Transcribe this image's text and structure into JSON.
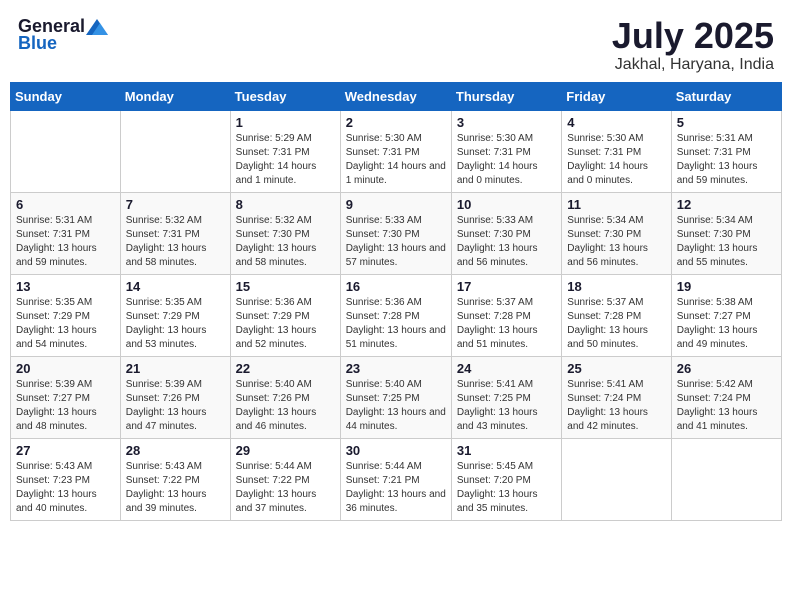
{
  "header": {
    "logo_general": "General",
    "logo_blue": "Blue",
    "title": "July 2025",
    "subtitle": "Jakhal, Haryana, India"
  },
  "days_of_week": [
    "Sunday",
    "Monday",
    "Tuesday",
    "Wednesday",
    "Thursday",
    "Friday",
    "Saturday"
  ],
  "weeks": [
    [
      {
        "day": "",
        "info": ""
      },
      {
        "day": "",
        "info": ""
      },
      {
        "day": "1",
        "info": "Sunrise: 5:29 AM\nSunset: 7:31 PM\nDaylight: 14 hours and 1 minute."
      },
      {
        "day": "2",
        "info": "Sunrise: 5:30 AM\nSunset: 7:31 PM\nDaylight: 14 hours and 1 minute."
      },
      {
        "day": "3",
        "info": "Sunrise: 5:30 AM\nSunset: 7:31 PM\nDaylight: 14 hours and 0 minutes."
      },
      {
        "day": "4",
        "info": "Sunrise: 5:30 AM\nSunset: 7:31 PM\nDaylight: 14 hours and 0 minutes."
      },
      {
        "day": "5",
        "info": "Sunrise: 5:31 AM\nSunset: 7:31 PM\nDaylight: 13 hours and 59 minutes."
      }
    ],
    [
      {
        "day": "6",
        "info": "Sunrise: 5:31 AM\nSunset: 7:31 PM\nDaylight: 13 hours and 59 minutes."
      },
      {
        "day": "7",
        "info": "Sunrise: 5:32 AM\nSunset: 7:31 PM\nDaylight: 13 hours and 58 minutes."
      },
      {
        "day": "8",
        "info": "Sunrise: 5:32 AM\nSunset: 7:30 PM\nDaylight: 13 hours and 58 minutes."
      },
      {
        "day": "9",
        "info": "Sunrise: 5:33 AM\nSunset: 7:30 PM\nDaylight: 13 hours and 57 minutes."
      },
      {
        "day": "10",
        "info": "Sunrise: 5:33 AM\nSunset: 7:30 PM\nDaylight: 13 hours and 56 minutes."
      },
      {
        "day": "11",
        "info": "Sunrise: 5:34 AM\nSunset: 7:30 PM\nDaylight: 13 hours and 56 minutes."
      },
      {
        "day": "12",
        "info": "Sunrise: 5:34 AM\nSunset: 7:30 PM\nDaylight: 13 hours and 55 minutes."
      }
    ],
    [
      {
        "day": "13",
        "info": "Sunrise: 5:35 AM\nSunset: 7:29 PM\nDaylight: 13 hours and 54 minutes."
      },
      {
        "day": "14",
        "info": "Sunrise: 5:35 AM\nSunset: 7:29 PM\nDaylight: 13 hours and 53 minutes."
      },
      {
        "day": "15",
        "info": "Sunrise: 5:36 AM\nSunset: 7:29 PM\nDaylight: 13 hours and 52 minutes."
      },
      {
        "day": "16",
        "info": "Sunrise: 5:36 AM\nSunset: 7:28 PM\nDaylight: 13 hours and 51 minutes."
      },
      {
        "day": "17",
        "info": "Sunrise: 5:37 AM\nSunset: 7:28 PM\nDaylight: 13 hours and 51 minutes."
      },
      {
        "day": "18",
        "info": "Sunrise: 5:37 AM\nSunset: 7:28 PM\nDaylight: 13 hours and 50 minutes."
      },
      {
        "day": "19",
        "info": "Sunrise: 5:38 AM\nSunset: 7:27 PM\nDaylight: 13 hours and 49 minutes."
      }
    ],
    [
      {
        "day": "20",
        "info": "Sunrise: 5:39 AM\nSunset: 7:27 PM\nDaylight: 13 hours and 48 minutes."
      },
      {
        "day": "21",
        "info": "Sunrise: 5:39 AM\nSunset: 7:26 PM\nDaylight: 13 hours and 47 minutes."
      },
      {
        "day": "22",
        "info": "Sunrise: 5:40 AM\nSunset: 7:26 PM\nDaylight: 13 hours and 46 minutes."
      },
      {
        "day": "23",
        "info": "Sunrise: 5:40 AM\nSunset: 7:25 PM\nDaylight: 13 hours and 44 minutes."
      },
      {
        "day": "24",
        "info": "Sunrise: 5:41 AM\nSunset: 7:25 PM\nDaylight: 13 hours and 43 minutes."
      },
      {
        "day": "25",
        "info": "Sunrise: 5:41 AM\nSunset: 7:24 PM\nDaylight: 13 hours and 42 minutes."
      },
      {
        "day": "26",
        "info": "Sunrise: 5:42 AM\nSunset: 7:24 PM\nDaylight: 13 hours and 41 minutes."
      }
    ],
    [
      {
        "day": "27",
        "info": "Sunrise: 5:43 AM\nSunset: 7:23 PM\nDaylight: 13 hours and 40 minutes."
      },
      {
        "day": "28",
        "info": "Sunrise: 5:43 AM\nSunset: 7:22 PM\nDaylight: 13 hours and 39 minutes."
      },
      {
        "day": "29",
        "info": "Sunrise: 5:44 AM\nSunset: 7:22 PM\nDaylight: 13 hours and 37 minutes."
      },
      {
        "day": "30",
        "info": "Sunrise: 5:44 AM\nSunset: 7:21 PM\nDaylight: 13 hours and 36 minutes."
      },
      {
        "day": "31",
        "info": "Sunrise: 5:45 AM\nSunset: 7:20 PM\nDaylight: 13 hours and 35 minutes."
      },
      {
        "day": "",
        "info": ""
      },
      {
        "day": "",
        "info": ""
      }
    ]
  ]
}
